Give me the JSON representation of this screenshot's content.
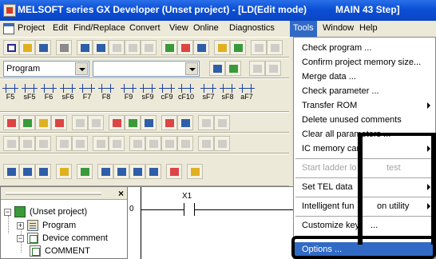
{
  "titlebar": {
    "title": "MELSOFT series GX Developer (Unset project) - [LD(Edit mode)",
    "mode": "MAIN   43 Step]"
  },
  "menubar": {
    "items": [
      "Project",
      "Edit",
      "Find/Replace",
      "Convert",
      "View",
      "Online",
      "Diagnostics",
      "Tools",
      "Window",
      "Help"
    ],
    "active": "Tools"
  },
  "toolbar": {
    "program_combo": "Program",
    "function_keys": [
      "F5",
      "sF5",
      "F6",
      "sF6",
      "F7",
      "F8",
      "F9",
      "sF9",
      "cF9",
      "cF10",
      "sF7",
      "sF8",
      "aF7"
    ]
  },
  "project_panel": {
    "close_glyph": "×",
    "tree": [
      {
        "label": "(Unset project)",
        "expander": "−"
      },
      {
        "label": "Program",
        "expander": "+"
      },
      {
        "label": "Device comment",
        "expander": "−"
      },
      {
        "label": "COMMENT",
        "expander": ""
      }
    ]
  },
  "ladder": {
    "step": "0",
    "device": "X1"
  },
  "tools_menu": {
    "items": [
      {
        "label": "Check program ...",
        "submenu": false,
        "disabled": false
      },
      {
        "label": "Confirm project memory size...",
        "submenu": false,
        "disabled": false
      },
      {
        "label": "Merge data ...",
        "submenu": false,
        "disabled": false
      },
      {
        "label": "Check parameter ...",
        "submenu": false,
        "disabled": false
      },
      {
        "label": "Transfer ROM",
        "submenu": true,
        "disabled": false
      },
      {
        "label": "Delete unused comments",
        "submenu": false,
        "disabled": false
      },
      {
        "label": "Clear all parameters ...",
        "submenu": false,
        "disabled": false
      },
      {
        "label": "IC memory car",
        "submenu": true,
        "disabled": false
      },
      {
        "label": "Start ladder lo",
        "suffix": "test",
        "submenu": false,
        "disabled": true
      },
      {
        "label": "Set TEL data",
        "submenu": true,
        "disabled": false
      },
      {
        "label": "Intelligent fun",
        "suffix": "on utility",
        "submenu": true,
        "disabled": false
      },
      {
        "label": "Customize key",
        "suffix": "...",
        "submenu": false,
        "disabled": false
      },
      {
        "label": "Options ...",
        "submenu": false,
        "disabled": false,
        "highlighted": true
      }
    ]
  },
  "colors": {
    "titlebar": "#0b4fd6",
    "menu_highlight": "#316ac5"
  }
}
